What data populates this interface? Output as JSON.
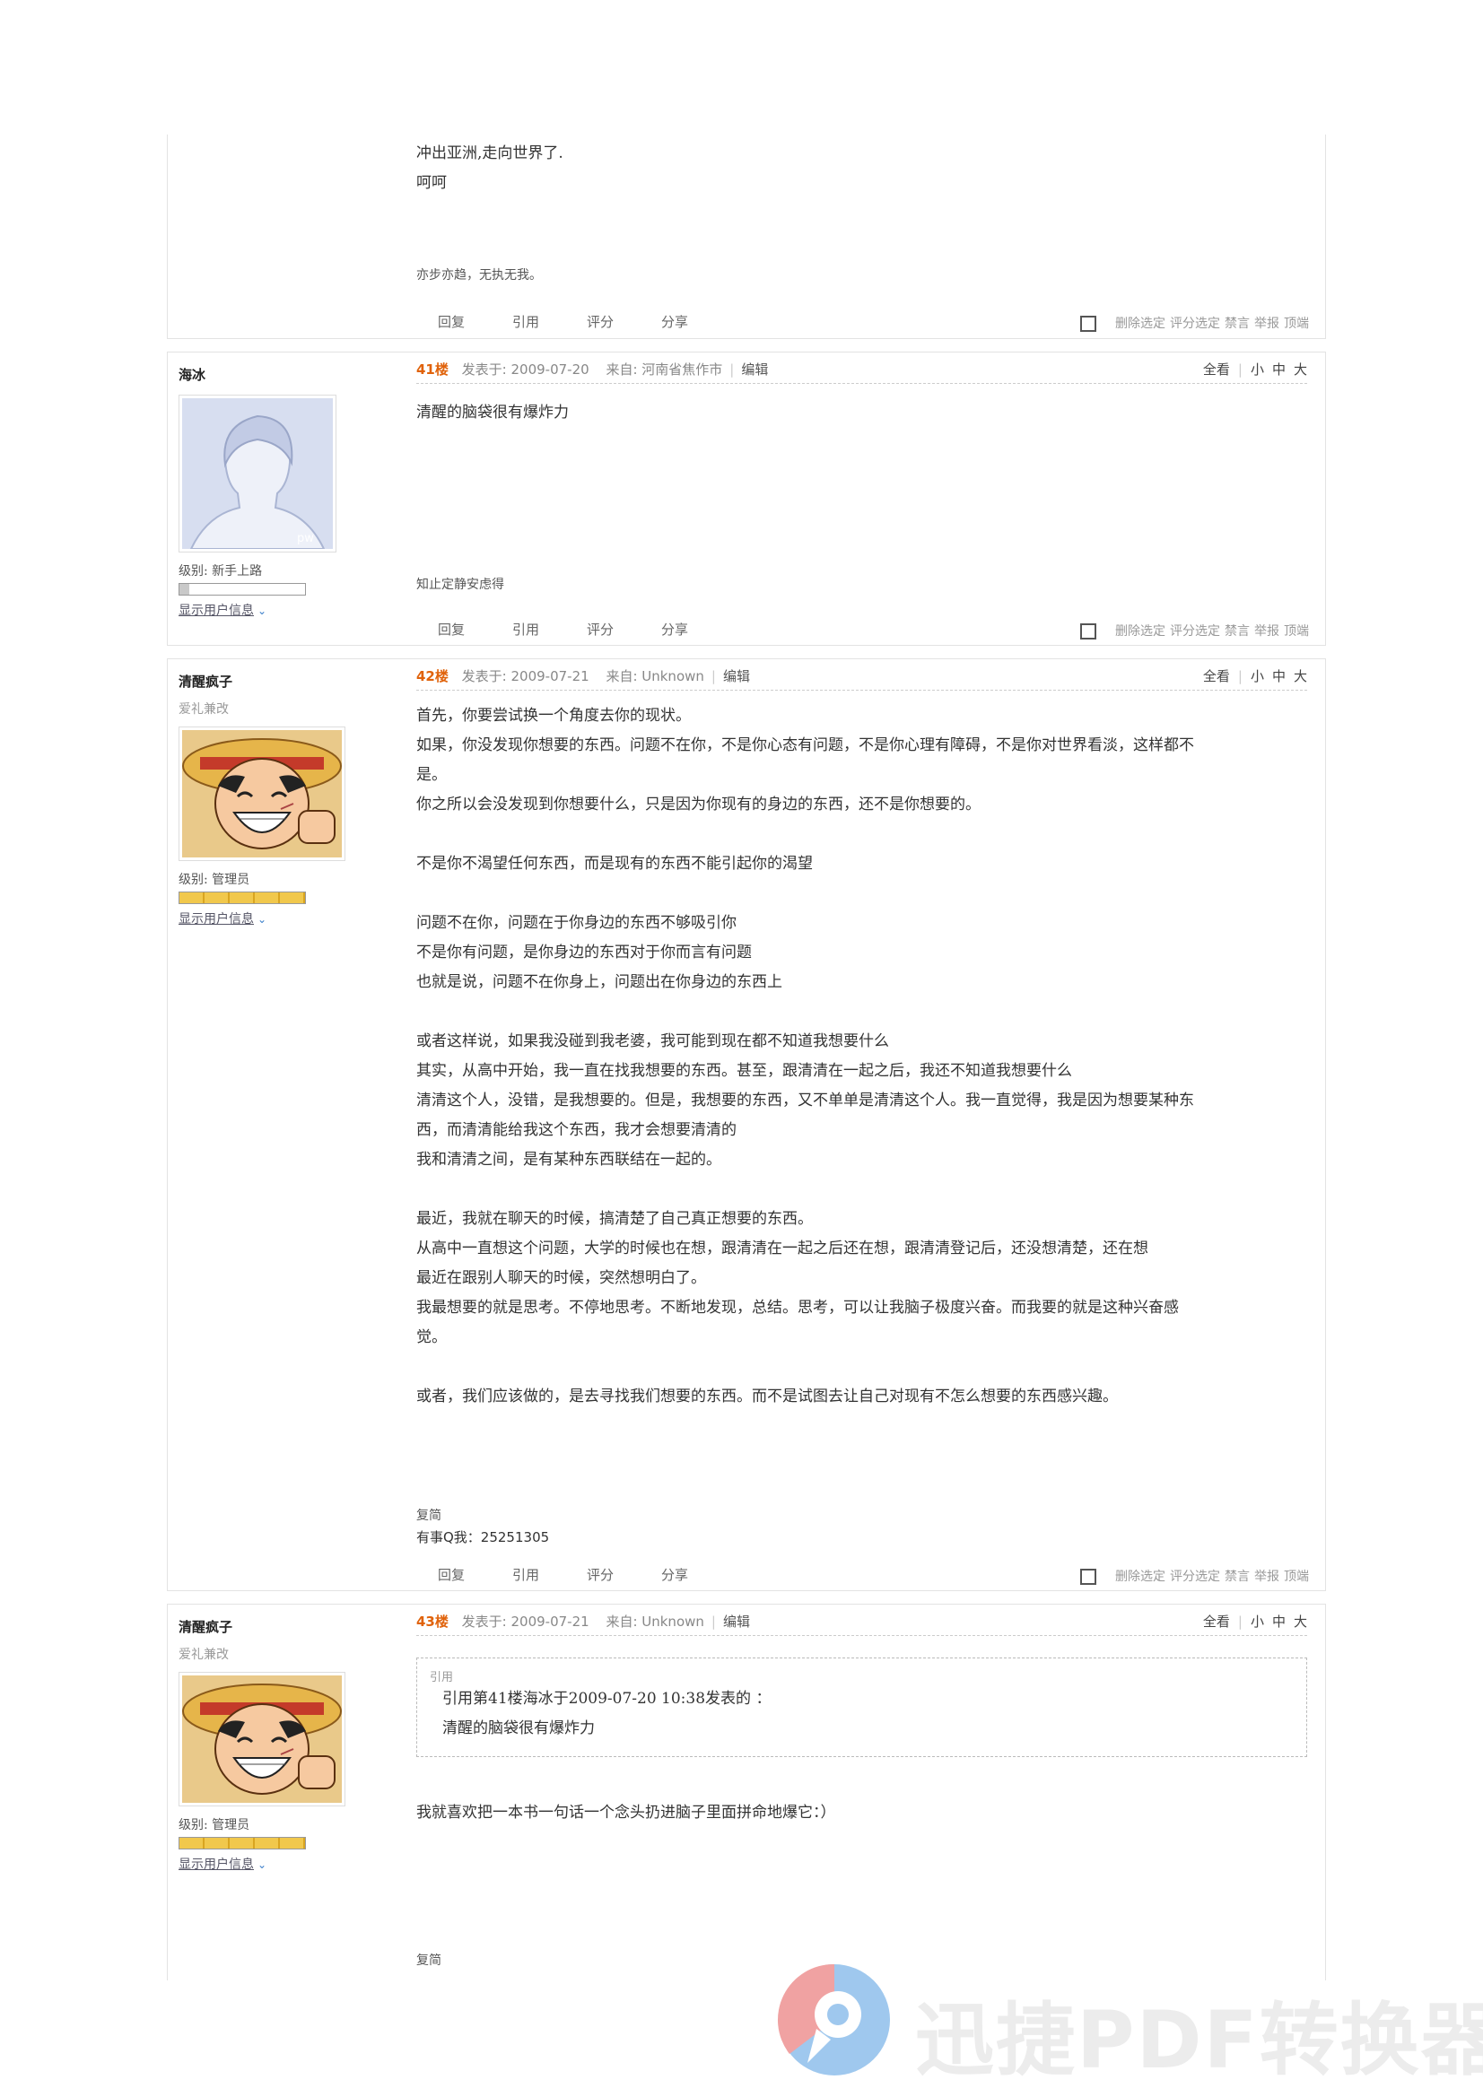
{
  "post40": {
    "body_lines": [
      "冲出亚洲,走向世界了.",
      "呵呵"
    ],
    "signature": "亦步亦趋，无执无我。",
    "actions": [
      "回复",
      "引用",
      "评分",
      "分享"
    ],
    "ops": [
      "删除选定",
      "评分选定",
      "禁言",
      "举报",
      "顶端"
    ]
  },
  "post41": {
    "user": {
      "name": "海冰",
      "level_label": "级别: 新手上路",
      "show_info": "显示用户信息",
      "level_fraction": 0.08
    },
    "header": {
      "floor": "41楼",
      "posted": "发表于: 2009-07-20",
      "from": "来自: 河南省焦作市",
      "edit": "编辑",
      "view_all": "全看",
      "sizes": [
        "小",
        "中",
        "大"
      ]
    },
    "body_lines": [
      "清醒的脑袋很有爆炸力"
    ],
    "signature": "知止定静安虑得",
    "actions": [
      "回复",
      "引用",
      "评分",
      "分享"
    ],
    "ops": [
      "删除选定",
      "评分选定",
      "禁言",
      "举报",
      "顶端"
    ]
  },
  "post42": {
    "user": {
      "name": "清醒疯子",
      "title": "爱礼兼改",
      "level_label": "级别: 管理员",
      "show_info": "显示用户信息",
      "level_fraction": 1.0
    },
    "header": {
      "floor": "42楼",
      "posted": "发表于: 2009-07-21",
      "from": "来自: Unknown",
      "edit": "编辑",
      "view_all": "全看",
      "sizes": [
        "小",
        "中",
        "大"
      ]
    },
    "body_lines": [
      "首先，你要尝试换一个角度去你的现状。",
      "如果，你没发现你想要的东西。问题不在你，不是你心态有问题，不是你心理有障碍，不是你对世界看淡，这样都不",
      "是。",
      "你之所以会没发现到你想要什么，只是因为你现有的身边的东西，还不是你想要的。",
      "",
      "不是你不渴望任何东西，而是现有的东西不能引起你的渴望",
      "",
      "问题不在你，问题在于你身边的东西不够吸引你",
      "不是你有问题，是你身边的东西对于你而言有问题",
      "也就是说，问题不在你身上，问题出在你身边的东西上",
      "",
      "或者这样说，如果我没碰到我老婆，我可能到现在都不知道我想要什么",
      "其实，从高中开始，我一直在找我想要的东西。甚至，跟清清在一起之后，我还不知道我想要什么",
      "清清这个人，没错，是我想要的。但是，我想要的东西，又不单单是清清这个人。我一直觉得，我是因为想要某种东",
      "西，而清清能给我这个东西，我才会想要清清的",
      "我和清清之间，是有某种东西联结在一起的。",
      "",
      "最近，我就在聊天的时候，搞清楚了自己真正想要的东西。",
      "从高中一直想这个问题，大学的时候也在想，跟清清在一起之后还在想，跟清清登记后，还没想清楚，还在想",
      "最近在跟别人聊天的时候，突然想明白了。",
      "我最想要的就是思考。不停地思考。不断地发现，总结。思考，可以让我脑子极度兴奋。而我要的就是这种兴奋感",
      "觉。",
      "",
      "或者，我们应该做的，是去寻找我们想要的东西。而不是试图去让自己对现有不怎么想要的东西感兴趣。"
    ],
    "sig_label": "复简",
    "qq": "有事Q我：25251305",
    "actions": [
      "回复",
      "引用",
      "评分",
      "分享"
    ],
    "ops": [
      "删除选定",
      "评分选定",
      "禁言",
      "举报",
      "顶端"
    ]
  },
  "post43": {
    "user": {
      "name": "清醒疯子",
      "title": "爱礼兼改",
      "level_label": "级别: 管理员",
      "show_info": "显示用户信息",
      "level_fraction": 1.0
    },
    "header": {
      "floor": "43楼",
      "posted": "发表于: 2009-07-21",
      "from": "来自: Unknown",
      "edit": "编辑",
      "view_all": "全看",
      "sizes": [
        "小",
        "中",
        "大"
      ]
    },
    "quote": {
      "label": "引用",
      "line1": "引用第41楼海冰于2009-07-20 10:38发表的 ：",
      "line2": "清醒的脑袋很有爆炸力"
    },
    "body_lines": [
      "我就喜欢把一本书一句话一个念头扔进脑子里面拼命地爆它：）"
    ],
    "sig_label": "复简"
  },
  "watermark": {
    "text": "迅捷PDF转换器"
  },
  "colors": {
    "floor": "#e0620a",
    "border": "#e3e3e3",
    "link": "#556"
  }
}
